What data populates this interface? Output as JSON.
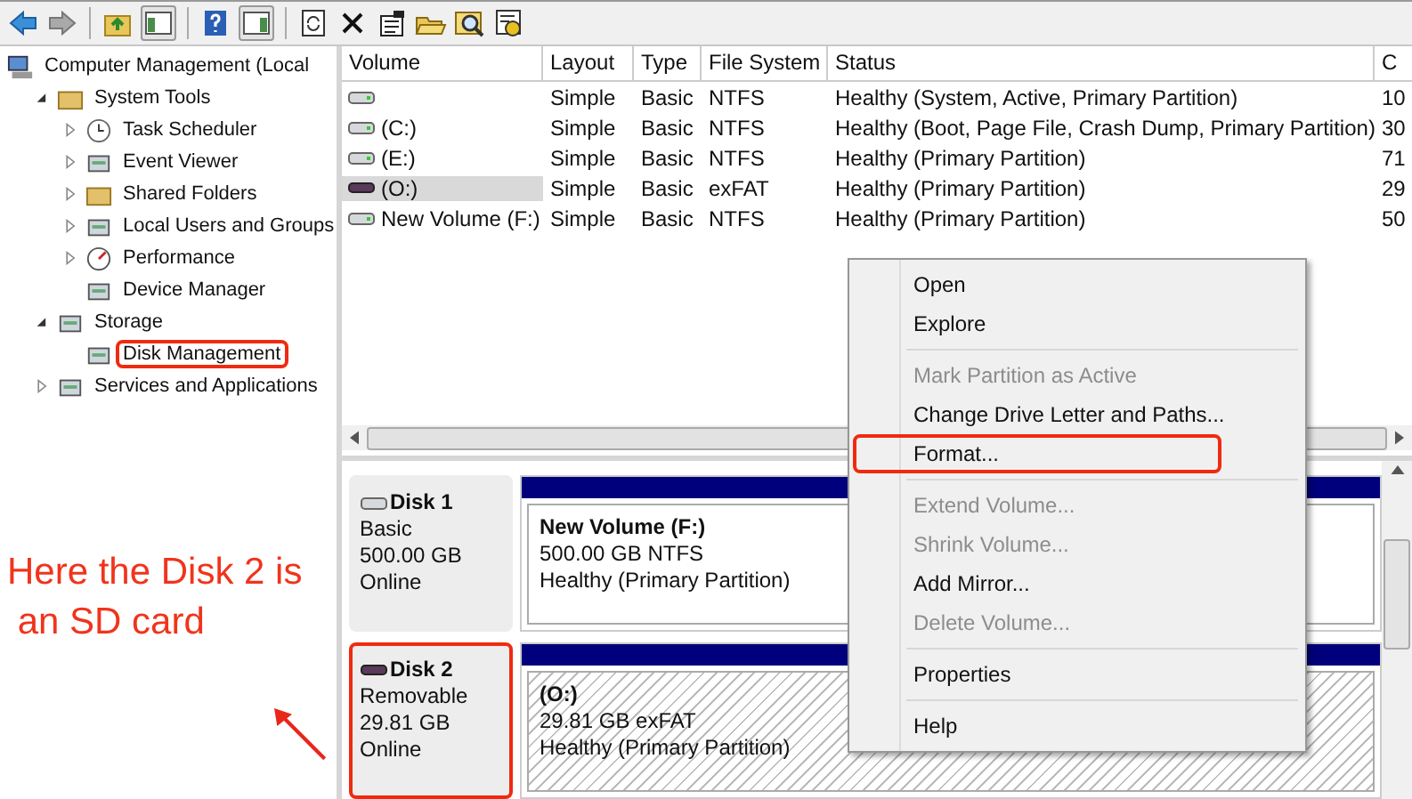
{
  "tree": [
    {
      "label": "Computer Management (Local",
      "children": [
        {
          "label": "System Tools",
          "expanded": true,
          "children": [
            {
              "label": "Task Scheduler",
              "expanded": false
            },
            {
              "label": "Event Viewer",
              "expanded": false
            },
            {
              "label": "Shared Folders",
              "expanded": false
            },
            {
              "label": "Local Users and Groups",
              "expanded": false
            },
            {
              "label": "Performance",
              "expanded": false
            },
            {
              "label": "Device Manager"
            }
          ]
        },
        {
          "label": "Storage",
          "expanded": true,
          "children": [
            {
              "label": "Disk Management",
              "annotated": true
            }
          ]
        },
        {
          "label": "Services and Applications",
          "expanded": false
        }
      ]
    }
  ],
  "annotation": {
    "lines": [
      "Here the Disk 2 is",
      " an SD card"
    ]
  },
  "volumes": {
    "columns": [
      "Volume",
      "Layout",
      "Type",
      "File System",
      "Status",
      "C"
    ],
    "rows": [
      {
        "kind": "hdd",
        "selected": false,
        "layout": "Simple",
        "type": "Basic",
        "file_system": "NTFS",
        "status": "Healthy (System, Active, Primary Partition)",
        "column_6": "10"
      },
      {
        "kind": "hdd",
        "selected": false,
        "volume": "(C:)",
        "layout": "Simple",
        "type": "Basic",
        "file_system": "NTFS",
        "status": "Healthy (Boot, Page File, Crash Dump, Primary Partition)",
        "column_6": "30"
      },
      {
        "kind": "hdd",
        "selected": false,
        "volume": "(E:)",
        "layout": "Simple",
        "type": "Basic",
        "file_system": "NTFS",
        "status": "Healthy (Primary Partition)",
        "column_6": "71"
      },
      {
        "kind": "removable",
        "selected": true,
        "volume": "(O:)",
        "layout": "Simple",
        "type": "Basic",
        "file_system": "exFAT",
        "status": "Healthy (Primary Partition)",
        "column_6": "29"
      },
      {
        "kind": "hdd",
        "selected": false,
        "volume": "New Volume (F:)",
        "layout": "Simple",
        "type": "Basic",
        "file_system": "NTFS",
        "status": "Healthy (Primary Partition)",
        "column_6": "50"
      }
    ]
  },
  "disks": [
    {
      "kind": "hdd",
      "name": "Disk 1",
      "type": "Basic",
      "size": "500.00 GB",
      "state": "Online",
      "annotated": false,
      "partition": {
        "name": "New Volume  (F:)",
        "size": "500.00 GB NTFS",
        "status": "Healthy (Primary Partition)",
        "selected": false
      }
    },
    {
      "kind": "removable",
      "name": "Disk 2",
      "type": "Removable",
      "size": "29.81 GB",
      "state": "Online",
      "annotated": true,
      "partition": {
        "name": "(O:)",
        "size": "29.81 GB exFAT",
        "status": "Healthy (Primary Partition)",
        "selected": true
      }
    }
  ],
  "context_menu": [
    {
      "kind": "item",
      "label": "Open",
      "disabled": false,
      "annotated": false
    },
    {
      "kind": "item",
      "label": "Explore",
      "disabled": false,
      "annotated": false
    },
    {
      "kind": "separator"
    },
    {
      "kind": "item",
      "label": "Mark Partition as Active",
      "disabled": true,
      "annotated": false
    },
    {
      "kind": "item",
      "label": "Change Drive Letter and Paths...",
      "disabled": false,
      "annotated": false
    },
    {
      "kind": "item",
      "label": "Format...",
      "disabled": false,
      "annotated": true
    },
    {
      "kind": "separator"
    },
    {
      "kind": "item",
      "label": "Extend Volume...",
      "disabled": true,
      "annotated": false
    },
    {
      "kind": "item",
      "label": "Shrink Volume...",
      "disabled": true,
      "annotated": false
    },
    {
      "kind": "item",
      "label": "Add Mirror...",
      "disabled": false,
      "annotated": false
    },
    {
      "kind": "item",
      "label": "Delete Volume...",
      "disabled": true,
      "annotated": false
    },
    {
      "kind": "separator"
    },
    {
      "kind": "item",
      "label": "Properties",
      "disabled": false,
      "annotated": false
    },
    {
      "kind": "separator"
    },
    {
      "kind": "item",
      "label": "Help",
      "disabled": false,
      "annotated": false
    }
  ]
}
